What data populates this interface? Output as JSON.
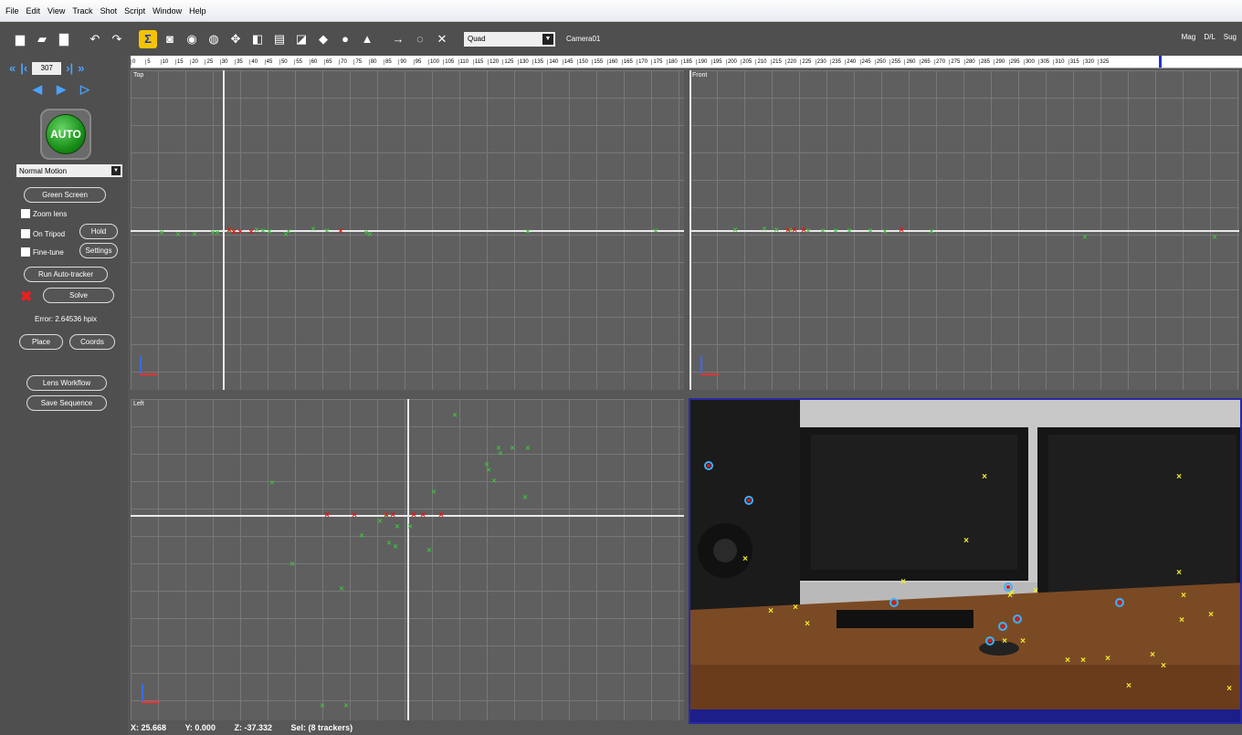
{
  "menu": [
    "File",
    "Edit",
    "View",
    "Track",
    "Shot",
    "Script",
    "Window",
    "Help"
  ],
  "toolbar": {
    "buttons": [
      {
        "name": "new-file-icon",
        "glyph": "▆"
      },
      {
        "name": "open-folder-icon",
        "glyph": "▰"
      },
      {
        "name": "save-icon",
        "glyph": "▇"
      },
      {
        "name": "undo-icon",
        "glyph": "↶"
      },
      {
        "name": "redo-icon",
        "glyph": "↷"
      },
      {
        "name": "sigma-icon",
        "glyph": "Σ"
      },
      {
        "name": "camera-icon",
        "glyph": "◙"
      },
      {
        "name": "tracker-icon",
        "glyph": "◉"
      },
      {
        "name": "sphere-icon",
        "glyph": "◍"
      },
      {
        "name": "move-icon",
        "glyph": "✥"
      },
      {
        "name": "exit-icon",
        "glyph": "◧"
      },
      {
        "name": "document-icon",
        "glyph": "▤"
      },
      {
        "name": "graph-icon",
        "glyph": "◪"
      },
      {
        "name": "cube-icon",
        "glyph": "◆"
      },
      {
        "name": "light-bulb-icon",
        "glyph": "●"
      },
      {
        "name": "paint-icon",
        "glyph": "▲"
      },
      {
        "name": "arrow-right-icon",
        "glyph": "→"
      },
      {
        "name": "zoom-icon",
        "glyph": "◌"
      },
      {
        "name": "crossed-tools-icon",
        "glyph": "✕"
      }
    ],
    "view_select": "Quad",
    "camera_name": "Camera01",
    "right_labels": [
      "Mag",
      "D/L",
      "Sug"
    ]
  },
  "timeline": {
    "ticks": [
      "0",
      "5",
      "10",
      "15",
      "20",
      "25",
      "30",
      "35",
      "40",
      "45",
      "50",
      "55",
      "60",
      "65",
      "70",
      "75",
      "80",
      "85",
      "90",
      "95",
      "100",
      "105",
      "110",
      "115",
      "120",
      "125",
      "130",
      "135",
      "140",
      "145",
      "150",
      "155",
      "160",
      "165",
      "170",
      "175",
      "180",
      "185",
      "190",
      "195",
      "200",
      "205",
      "210",
      "215",
      "220",
      "225",
      "230",
      "235",
      "240",
      "245",
      "250",
      "255",
      "260",
      "265",
      "270",
      "275",
      "280",
      "285",
      "290",
      "295",
      "300",
      "305",
      "310",
      "315",
      "320",
      "325"
    ]
  },
  "sidebar": {
    "frame": "307",
    "auto_label": "AUTO",
    "motion_type": "Normal Motion",
    "green_screen": "Green Screen",
    "zoom_lens": "Zoom lens",
    "on_tripod": "On Tripod",
    "hold": "Hold",
    "fine_tune": "Fine-tune",
    "settings": "Settings",
    "run_autotracker": "Run Auto-tracker",
    "solve": "Solve",
    "error": "Error: 2.64536 hpix",
    "place": "Place",
    "coords": "Coords",
    "lens_workflow": "Lens Workflow",
    "save_sequence": "Save Sequence"
  },
  "viewports": {
    "top": "Top",
    "front": "Front",
    "left": "Left"
  },
  "status": {
    "x_label": "X:",
    "x": "25.668",
    "y_label": "Y:",
    "y": "0.000",
    "z_label": "Z:",
    "z": "-37.332",
    "sel": "Sel: (8 trackers)"
  },
  "colors": {
    "accent": "#f5c400",
    "tracker_green": "#3fbf3f",
    "tracker_red": "#e21515",
    "tracker_yellow": "#f4ef2a",
    "camera_frame": "#2a2aa0"
  }
}
